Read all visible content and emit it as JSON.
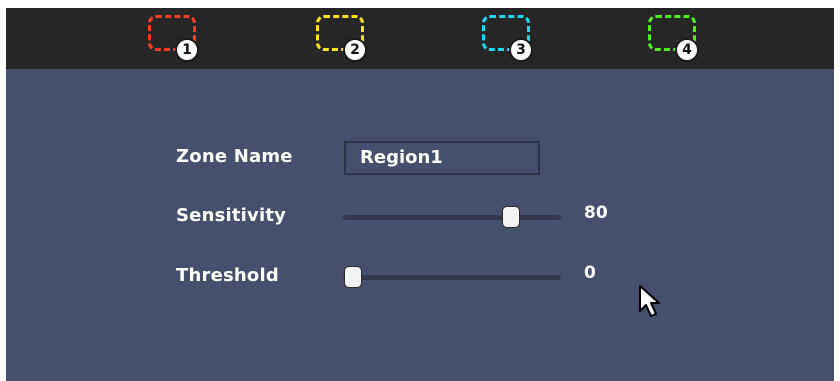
{
  "zones": [
    {
      "label": "1",
      "color": "#ff3b1f"
    },
    {
      "label": "2",
      "color": "#ffe21b"
    },
    {
      "label": "3",
      "color": "#1ed9f2"
    },
    {
      "label": "4",
      "color": "#4cf21e"
    }
  ],
  "form": {
    "zone_name_label": "Zone Name",
    "zone_name_value": "Region1",
    "sensitivity_label": "Sensitivity",
    "sensitivity_value": "80",
    "sensitivity_level": 0.8,
    "threshold_label": "Threshold",
    "threshold_value": "0",
    "threshold_level": 0.0
  },
  "colors": {
    "panel_background": "#44506c",
    "zone_bar_background": "#262626"
  }
}
